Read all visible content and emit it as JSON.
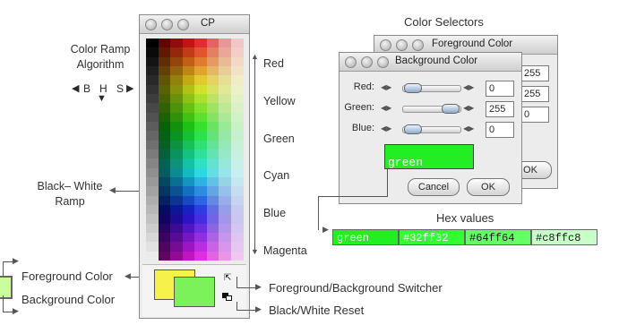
{
  "palette": {
    "title": "CP",
    "labels": {
      "algo": "Color Ramp\nAlgorithm",
      "b": "B",
      "h": "H",
      "s": "S",
      "bw_ramp": "Black– White\nRamp",
      "red": "Red",
      "yellow": "Yellow",
      "green": "Green",
      "cyan": "Cyan",
      "blue": "Blue",
      "magenta": "Magenta",
      "fg": "Foreground Color",
      "bg": "Background Color",
      "switcher": "Foreground/Background Switcher",
      "reset": "Black/White Reset"
    },
    "colors": {
      "fg": "#f6f24a",
      "bg": "#7cf25a"
    }
  },
  "selectors": {
    "heading": "Color Selectors",
    "fg_window": {
      "title": "Foreground Color",
      "values": [
        "255",
        "255",
        "0"
      ],
      "ok": "OK"
    },
    "bg_window": {
      "title": "Background Color",
      "rows": [
        {
          "label": "Red:",
          "value": "0"
        },
        {
          "label": "Green:",
          "value": "255"
        },
        {
          "label": "Blue:",
          "value": "0"
        }
      ],
      "swatch_text": "green",
      "swatch_color": "#22ee22",
      "cancel": "Cancel",
      "ok": "OK"
    }
  },
  "hex": {
    "heading": "Hex values",
    "items": [
      {
        "text": "green",
        "bg": "#22ee22",
        "fg": "#ffffff"
      },
      {
        "text": "#32ff32",
        "bg": "#32ff32",
        "fg": "#ffffff"
      },
      {
        "text": "#64ff64",
        "bg": "#64ff64",
        "fg": "#1a1a1a"
      },
      {
        "text": "#c8ffc8",
        "bg": "#c8ffc8",
        "fg": "#1a1a1a"
      }
    ]
  }
}
